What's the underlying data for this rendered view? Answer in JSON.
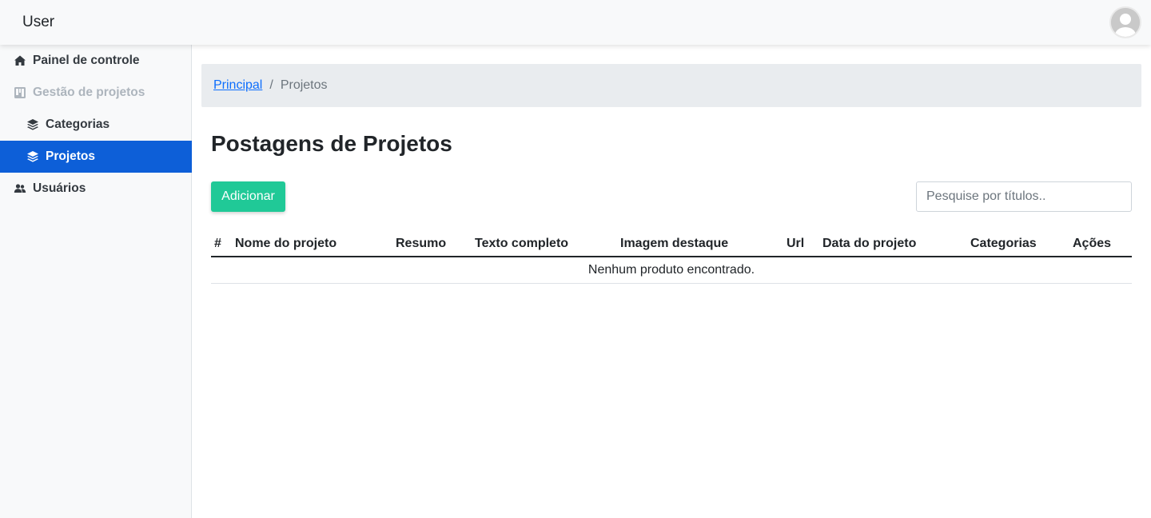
{
  "header": {
    "brand": "User"
  },
  "sidebar": {
    "items": [
      {
        "label": "Painel de controle",
        "icon": "home-icon",
        "state": "normal"
      },
      {
        "label": "Gestão de projetos",
        "icon": "kanban-icon",
        "state": "disabled"
      },
      {
        "label": "Categorias",
        "icon": "layers-icon",
        "state": "normal"
      },
      {
        "label": "Projetos",
        "icon": "layers-icon",
        "state": "active"
      },
      {
        "label": "Usuários",
        "icon": "users-icon",
        "state": "normal"
      }
    ]
  },
  "breadcrumb": {
    "home": "Principal",
    "separator": "/",
    "current": "Projetos"
  },
  "page": {
    "title": "Postagens de Projetos",
    "add_label": "Adicionar",
    "search_placeholder": "Pesquise por títulos.."
  },
  "table": {
    "columns": [
      "#",
      "Nome do projeto",
      "Resumo",
      "Texto completo",
      "Imagem destaque",
      "Url",
      "Data do projeto",
      "Categorias",
      "Ações"
    ],
    "empty_message": "Nenhum produto encontrado."
  },
  "colors": {
    "active_nav": "#0d5fd8",
    "add_button": "#20c997",
    "link": "#0d6efd"
  }
}
